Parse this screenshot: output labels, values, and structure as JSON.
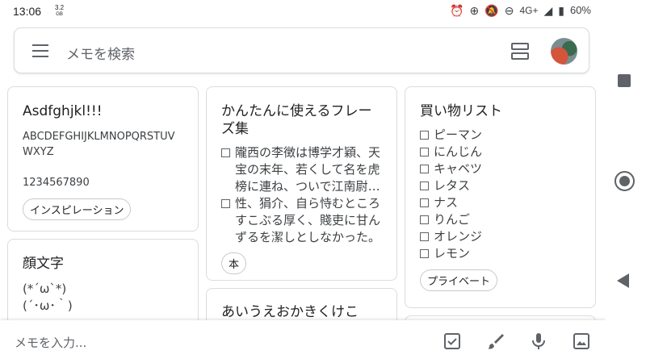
{
  "status_bar": {
    "time": "13:06",
    "data_speed_value": "3.2",
    "data_speed_unit": "GB",
    "network": "4G+",
    "battery": "60%"
  },
  "search": {
    "placeholder": "メモを検索"
  },
  "notes": [
    {
      "title": "Asdfghjkl!!!",
      "body": "ABCDEFGHIJKLMNOPQRSTUVWXYZ\n\n1234567890",
      "label": "インスピレーション"
    },
    {
      "title": "顔文字",
      "body": "(*´ω`*)\n(´･ω･｀)"
    },
    {
      "title": "かんたんに使えるフレーズ集",
      "items": [
        "隴西の李徴は博学才穎、天宝の末年、若くして名を虎榜に連ね、ついで江南尉に補せられたが",
        "性、狷介、自ら恃むところすこぶる厚く、賤吏に甘んずるを潔しとしなかった。"
      ],
      "label": "本"
    },
    {
      "title": "あいうえおかきくけこ"
    },
    {
      "title": "買い物リスト",
      "items": [
        "ピーマン",
        "にんじん",
        "キャベツ",
        "レタス",
        "ナス",
        "りんご",
        "オレンジ",
        "レモン"
      ],
      "label": "プライベート"
    }
  ],
  "bottom_bar": {
    "placeholder": "メモを入力..."
  },
  "icons": {
    "status": [
      "alarm-icon",
      "data-saver-icon",
      "notifications-off-icon",
      "do-not-disturb-icon",
      "signal-icon",
      "battery-icon"
    ],
    "bottom": [
      "checkbox-icon",
      "brush-icon",
      "mic-icon",
      "image-icon"
    ],
    "nav": [
      "recent-apps-icon",
      "home-icon",
      "back-icon"
    ]
  },
  "colors": {
    "text": "#202124",
    "icon": "#5f6368",
    "border": "#dadce0"
  }
}
